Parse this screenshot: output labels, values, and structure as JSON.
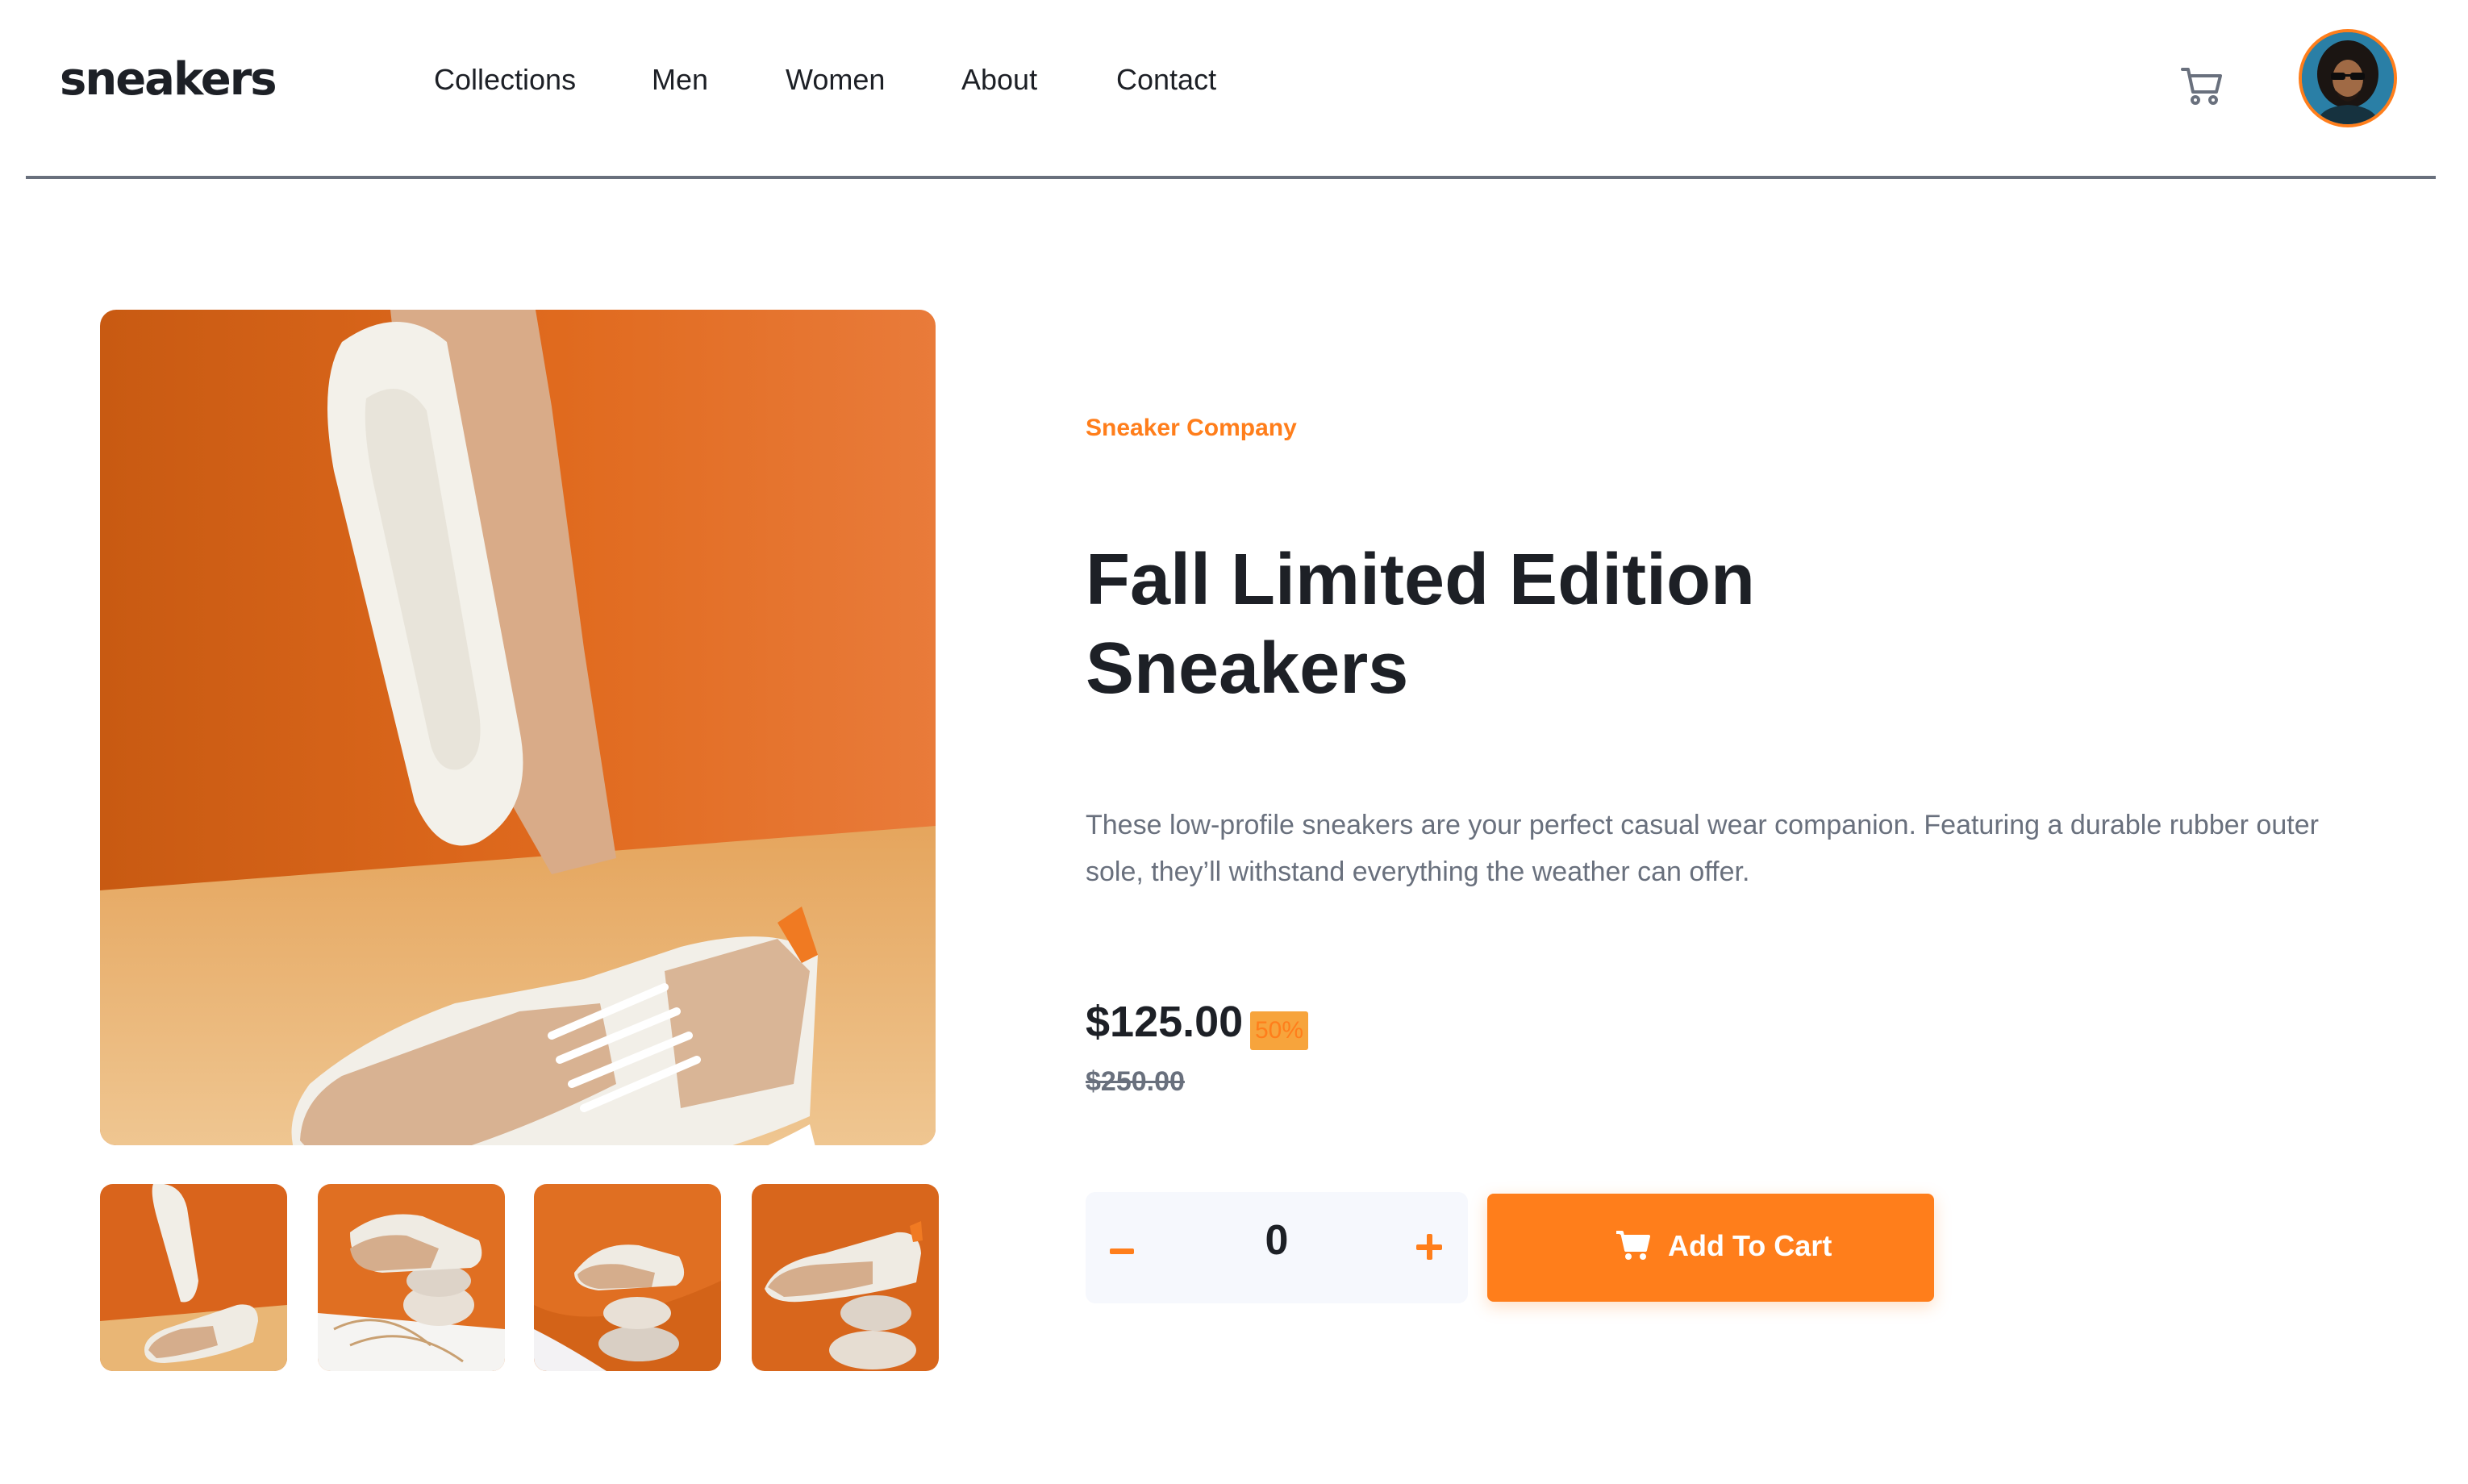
{
  "header": {
    "logo": "sneakers",
    "nav": [
      "Collections",
      "Men",
      "Women",
      "About",
      "Contact"
    ]
  },
  "product": {
    "company": "Sneaker Company",
    "title_line1": "Fall Limited Edition",
    "title_line2": "Sneakers",
    "description": "These low-profile sneakers are your perfect casual wear companion. Featuring a durable rubber outer sole, they’ll withstand everything the weather can offer.",
    "price": "$125.00",
    "discount": "50%",
    "original_price": "$250.00",
    "quantity": "0",
    "add_to_cart_label": "Add To Cart"
  },
  "colors": {
    "accent": "#ff7e1b",
    "accent_pale": "#f7a43c",
    "dark": "#1d2026",
    "grey": "#69707d",
    "light": "#f6f8fd"
  },
  "icons": {
    "cart": "cart-icon",
    "quantity_minus": "minus-icon",
    "quantity_plus": "plus-icon",
    "button_cart": "cart-filled-icon"
  }
}
